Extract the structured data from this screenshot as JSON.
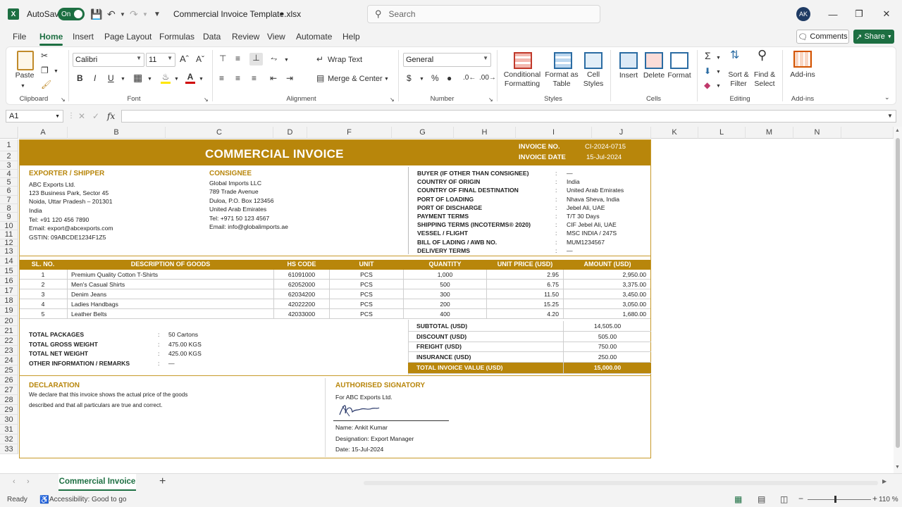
{
  "titlebar": {
    "autosave_label": "AutoSave",
    "autosave_state": "On",
    "filename": "Commercial Invoice Template.xlsx",
    "search_placeholder": "Search",
    "avatar_initials": "AK"
  },
  "menu": {
    "tabs": [
      "File",
      "Home",
      "Insert",
      "Page Layout",
      "Formulas",
      "Data",
      "Review",
      "View",
      "Automate",
      "Help"
    ],
    "active": "Home",
    "comments": "Comments",
    "share": "Share"
  },
  "ribbon": {
    "clipboard": {
      "paste": "Paste",
      "group": "Clipboard"
    },
    "font": {
      "name": "Calibri",
      "size": "11",
      "group": "Font"
    },
    "alignment": {
      "wrap": "Wrap Text",
      "merge": "Merge & Center",
      "group": "Alignment"
    },
    "number": {
      "format": "General",
      "group": "Number"
    },
    "styles": {
      "conditional": "Conditional",
      "conditional2": "Formatting",
      "format_table": "Format as",
      "format_table2": "Table",
      "cell_styles": "Cell",
      "cell_styles2": "Styles",
      "group": "Styles"
    },
    "cells": {
      "insert": "Insert",
      "delete": "Delete",
      "format": "Format",
      "group": "Cells"
    },
    "editing": {
      "sort": "Sort &",
      "sort2": "Filter",
      "find": "Find &",
      "find2": "Select",
      "group": "Editing"
    },
    "addins": {
      "label": "Add-ins",
      "group": "Add-ins"
    }
  },
  "formula_bar": {
    "name_box": "A1",
    "fx": "fx",
    "value": ""
  },
  "columns": [
    "A",
    "B",
    "C",
    "D",
    "F",
    "G",
    "H",
    "I",
    "J",
    "K",
    "L",
    "M",
    "N"
  ],
  "rows": [
    "1",
    "2",
    "3",
    "4",
    "5",
    "6",
    "7",
    "8",
    "9",
    "10",
    "11",
    "12",
    "13",
    "14",
    "15",
    "16",
    "17",
    "18",
    "19",
    "20",
    "21",
    "22",
    "23",
    "24",
    "25",
    "26",
    "27",
    "28",
    "29",
    "30",
    "31",
    "32",
    "33"
  ],
  "invoice": {
    "title": "COMMERCIAL INVOICE",
    "invoice_no_label": "INVOICE NO.",
    "invoice_no": "CI-2024-0715",
    "invoice_date_label": "INVOICE DATE",
    "invoice_date": "15-Jul-2024",
    "exporter": {
      "heading": "EXPORTER / SHIPPER",
      "lines": [
        "ABC Exports Ltd.",
        "123 Business Park, Sector 45",
        "Noida, Uttar Pradesh – 201301",
        "India",
        "Tel: +91 120 456 7890",
        "Email: export@abcexports.com",
        "GSTIN: 09ABCDE1234F1Z5"
      ]
    },
    "consignee": {
      "heading": "CONSIGNEE",
      "lines": [
        "Global Imports LLC",
        "789 Trade Avenue",
        "Duloa, P.O. Box 123456",
        "United Arab Emirates",
        "Tel: +971 50 123 4567",
        "Email: info@globalimports.ae"
      ]
    },
    "shipping": [
      {
        "label": "BUYER (IF OTHER THAN CONSIGNEE)",
        "value": "—"
      },
      {
        "label": "COUNTRY OF ORIGIN",
        "value": "India"
      },
      {
        "label": "COUNTRY OF FINAL DESTINATION",
        "value": "United Arab Emirates"
      },
      {
        "label": "PORT OF LOADING",
        "value": "Nhava Sheva, India"
      },
      {
        "label": "PORT OF DISCHARGE",
        "value": "Jebel Ali, UAE"
      },
      {
        "label": "PAYMENT TERMS",
        "value": "T/T 30 Days"
      },
      {
        "label": "SHIPPING TERMS (INCOTERMS® 2020)",
        "value": "CIF Jebel Ali, UAE"
      },
      {
        "label": "VESSEL / FLIGHT",
        "value": "MSC INDIA / 247S"
      },
      {
        "label": "BILL OF LADING / AWB NO.",
        "value": "MUM1234567"
      },
      {
        "label": "DELIVERY TERMS",
        "value": "—"
      }
    ],
    "table_headers": [
      "SL. NO.",
      "DESCRIPTION OF GOODS",
      "HS CODE",
      "UNIT",
      "QUANTITY",
      "UNIT PRICE (USD)",
      "AMOUNT (USD)"
    ],
    "items": [
      {
        "sl": "1",
        "desc": "Premium Quality Cotton T-Shirts",
        "hs": "61091000",
        "unit": "PCS",
        "qty": "1,000",
        "price": "2.95",
        "amount": "2,950.00"
      },
      {
        "sl": "2",
        "desc": "Men's Casual Shirts",
        "hs": "62052000",
        "unit": "PCS",
        "qty": "500",
        "price": "6.75",
        "amount": "3,375.00"
      },
      {
        "sl": "3",
        "desc": "Denim Jeans",
        "hs": "62034200",
        "unit": "PCS",
        "qty": "300",
        "price": "11.50",
        "amount": "3,450.00"
      },
      {
        "sl": "4",
        "desc": "Ladies Handbags",
        "hs": "42022200",
        "unit": "PCS",
        "qty": "200",
        "price": "15.25",
        "amount": "3,050.00"
      },
      {
        "sl": "5",
        "desc": "Leather Belts",
        "hs": "42033000",
        "unit": "PCS",
        "qty": "400",
        "price": "4.20",
        "amount": "1,680.00"
      }
    ],
    "packing": [
      {
        "label": "TOTAL PACKAGES",
        "value": "50 Cartons"
      },
      {
        "label": "TOTAL GROSS WEIGHT",
        "value": "475.00 KGS"
      },
      {
        "label": "TOTAL NET WEIGHT",
        "value": "425.00 KGS"
      },
      {
        "label": "OTHER INFORMATION / REMARKS",
        "value": "—"
      }
    ],
    "totals": [
      {
        "label": "SUBTOTAL (USD)",
        "value": "14,505.00"
      },
      {
        "label": "DISCOUNT (USD)",
        "value": "505.00"
      },
      {
        "label": "FREIGHT (USD)",
        "value": "750.00"
      },
      {
        "label": "INSURANCE (USD)",
        "value": "250.00"
      }
    ],
    "grand_total": {
      "label": "TOTAL INVOICE VALUE (USD)",
      "value": "15,000.00"
    },
    "declaration": {
      "heading": "DECLARATION",
      "line1": "We declare that this invoice shows the actual price of the goods",
      "line2": "described and that all particulars are true and correct."
    },
    "signatory": {
      "heading": "AUTHORISED SIGNATORY",
      "for": "For ABC Exports Ltd.",
      "name": "Name: Ankit Kumar",
      "designation": "Designation: Export Manager",
      "date": "Date: 15-Jul-2024"
    }
  },
  "sheet_tab": "Commercial Invoice",
  "status": {
    "ready": "Ready",
    "accessibility": "Accessibility: Good to go",
    "zoom": "110 %"
  },
  "colors": {
    "accent": "#b8860b",
    "excel_green": "#1d6f42"
  }
}
